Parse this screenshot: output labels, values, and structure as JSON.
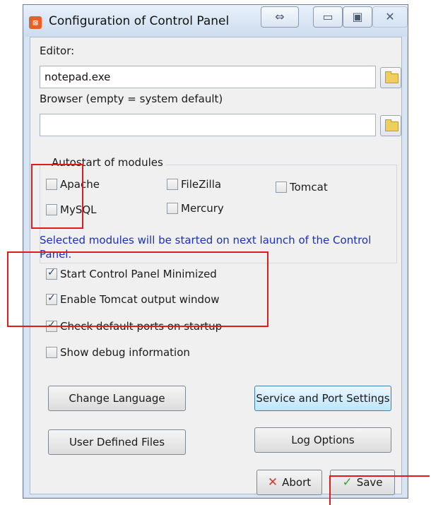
{
  "window": {
    "title": "Configuration of Control Panel",
    "icon_text": "⊠",
    "buttons": {
      "resize": "⇔",
      "minimize": "▭",
      "maximize": "▣",
      "close": "✕"
    }
  },
  "editor": {
    "label": "Editor:",
    "value": "notepad.exe"
  },
  "browser": {
    "label": "Browser (empty = system default)",
    "value": ""
  },
  "autostart": {
    "title": "Autostart of modules",
    "modules": [
      {
        "label": "Apache",
        "checked": false
      },
      {
        "label": "FileZilla",
        "checked": false
      },
      {
        "label": "Tomcat",
        "checked": false
      },
      {
        "label": "MySQL",
        "checked": false
      },
      {
        "label": "Mercury",
        "checked": false
      }
    ],
    "note": "Selected modules will be started on next launch of the Control Panel."
  },
  "options": [
    {
      "label": "Start Control Panel Minimized",
      "checked": true
    },
    {
      "label": "Enable Tomcat output window",
      "checked": true
    },
    {
      "label": "Check default ports on startup",
      "checked": true
    },
    {
      "label": "Show debug information",
      "checked": false
    }
  ],
  "buttons": {
    "change_language": "Change Language",
    "service_port": "Service and Port Settings",
    "user_defined_files": "User Defined Files",
    "log_options": "Log Options",
    "abort": "Abort",
    "save": "Save"
  },
  "colors": {
    "note_text": "#1c2fb8",
    "annotation": "#e01b1b",
    "accent_hover": "#bee6fd"
  }
}
